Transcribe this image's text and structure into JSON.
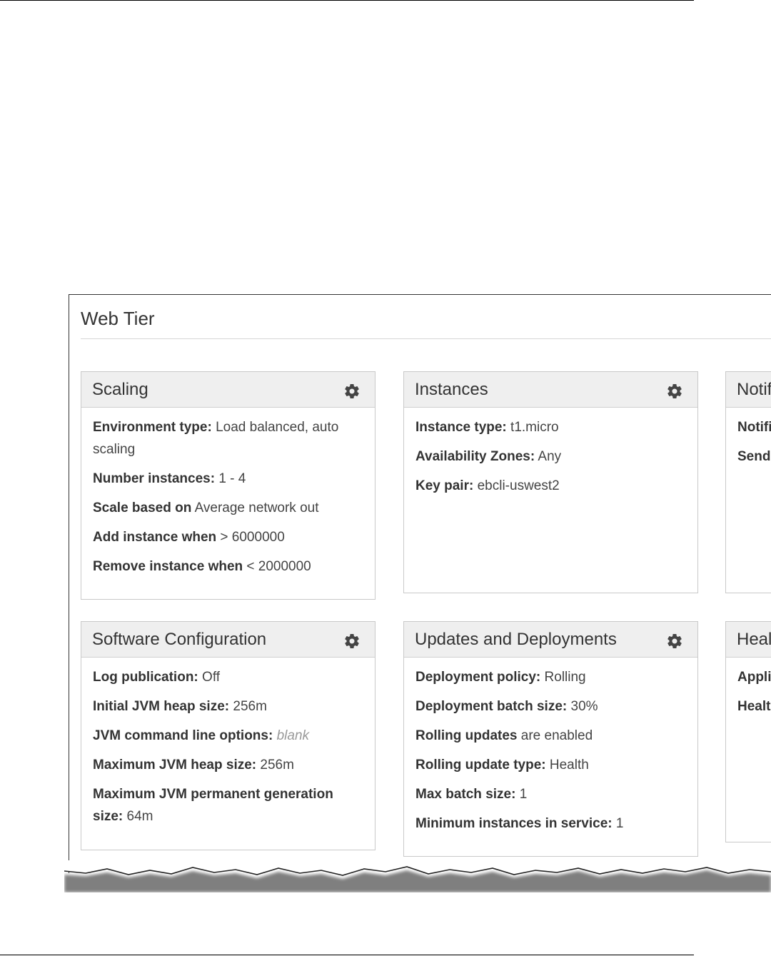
{
  "tier": {
    "title": "Web Tier"
  },
  "panels": {
    "scaling": {
      "title": "Scaling",
      "rows": [
        {
          "k": "Environment type:",
          "v": "Load balanced, auto",
          "v2": "scaling"
        },
        {
          "k": "Number instances:",
          "v": "1 - 4"
        },
        {
          "k": "Scale based on",
          "v": "Average network out"
        },
        {
          "k": "Add instance when",
          "v": "> 6000000"
        },
        {
          "k": "Remove instance when",
          "v": "< 2000000"
        }
      ]
    },
    "instances": {
      "title": "Instances",
      "rows": [
        {
          "k": "Instance type:",
          "v": "t1.micro"
        },
        {
          "k": "Availability Zones:",
          "v": "Any"
        },
        {
          "k": "Key pair:",
          "v": "ebcli-uswest2"
        }
      ]
    },
    "notifications": {
      "title": "Notif",
      "rows": [
        {
          "k": "Notifi"
        },
        {
          "k": "Send"
        }
      ]
    },
    "software": {
      "title": "Software Configuration",
      "rows": [
        {
          "k": "Log publication:",
          "v": "Off"
        },
        {
          "k": "Initial JVM heap size:",
          "v": "256m"
        },
        {
          "k": "JVM command line options:",
          "v": "blank"
        },
        {
          "k": "Maximum JVM heap size:",
          "v": "256m"
        },
        {
          "k": "Maximum JVM permanent generation",
          "k2": "size:",
          "v": "64m"
        }
      ]
    },
    "updates": {
      "title": "Updates and Deployments",
      "rows": [
        {
          "k": "Deployment policy:",
          "v": "Rolling"
        },
        {
          "k": "Deployment batch size:",
          "v": "30%"
        },
        {
          "k": "Rolling updates",
          "v": "are enabled"
        },
        {
          "k": "Rolling update type:",
          "v": "Health"
        },
        {
          "k": "Max batch size:",
          "v": "1"
        },
        {
          "k": "Minimum instances in service:",
          "v": "1"
        }
      ]
    },
    "health": {
      "title": "Heal",
      "rows": [
        {
          "k": "Appli"
        },
        {
          "k": "Healt"
        }
      ]
    }
  }
}
